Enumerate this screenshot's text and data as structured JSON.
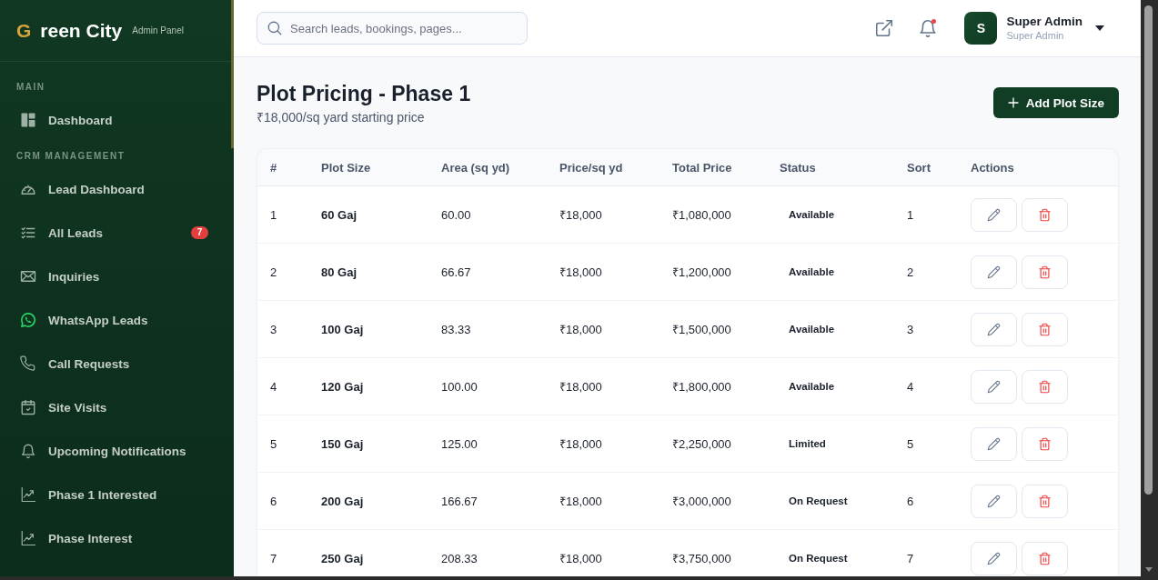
{
  "sidebar": {
    "logo": {
      "mark": "G",
      "name": "reen City",
      "subtitle": "Admin Panel"
    },
    "sections": [
      {
        "label": "MAIN",
        "items": [
          {
            "label": "Dashboard",
            "kind": "dashboard",
            "selected": false
          }
        ]
      },
      {
        "label": "CRM MANAGEMENT",
        "items": [
          {
            "label": "Lead Dashboard",
            "kind": "gauge",
            "selected": false
          },
          {
            "label": "All Leads",
            "kind": "list",
            "badge": "7",
            "selected": false
          },
          {
            "label": "Inquiries",
            "kind": "mail",
            "selected": false
          },
          {
            "label": "WhatsApp Leads",
            "kind": "whatsapp",
            "selected": false
          },
          {
            "label": "Call Requests",
            "kind": "phone",
            "selected": false
          },
          {
            "label": "Site Visits",
            "kind": "calendar",
            "selected": false
          },
          {
            "label": "Upcoming Notifications",
            "kind": "bell",
            "selected": false
          },
          {
            "label": "Phase 1 Interested",
            "kind": "chart",
            "selected": false
          },
          {
            "label": "Phase Interest",
            "kind": "chart",
            "selected": false
          }
        ]
      }
    ]
  },
  "topbar": {
    "search": {
      "placeholder": "Search leads, bookings, pages..."
    },
    "notifications": {
      "unread": true
    },
    "user": {
      "initial": "S",
      "name": "Super Admin",
      "role": "Super Admin"
    }
  },
  "page": {
    "title": "Plot Pricing - Phase 1",
    "subtitle": "₹18,000/sq yard starting price",
    "add_button": "Add Plot Size"
  },
  "table": {
    "columns": [
      "#",
      "Plot Size",
      "Area (sq yd)",
      "Price/sq yd",
      "Total Price",
      "Status",
      "Sort",
      "Actions"
    ],
    "rows": [
      {
        "index": "1",
        "plot_size": "60 Gaj",
        "area": "60.00",
        "price_per_sq_yd": "₹18,000",
        "total_price": "₹1,080,000",
        "status": "Available",
        "sort": "1"
      },
      {
        "index": "2",
        "plot_size": "80 Gaj",
        "area": "66.67",
        "price_per_sq_yd": "₹18,000",
        "total_price": "₹1,200,000",
        "status": "Available",
        "sort": "2"
      },
      {
        "index": "3",
        "plot_size": "100 Gaj",
        "area": "83.33",
        "price_per_sq_yd": "₹18,000",
        "total_price": "₹1,500,000",
        "status": "Available",
        "sort": "3"
      },
      {
        "index": "4",
        "plot_size": "120 Gaj",
        "area": "100.00",
        "price_per_sq_yd": "₹18,000",
        "total_price": "₹1,800,000",
        "status": "Available",
        "sort": "4"
      },
      {
        "index": "5",
        "plot_size": "150 Gaj",
        "area": "125.00",
        "price_per_sq_yd": "₹18,000",
        "total_price": "₹2,250,000",
        "status": "Limited",
        "sort": "5"
      },
      {
        "index": "6",
        "plot_size": "200 Gaj",
        "area": "166.67",
        "price_per_sq_yd": "₹18,000",
        "total_price": "₹3,000,000",
        "status": "On Request",
        "sort": "6"
      },
      {
        "index": "7",
        "plot_size": "250 Gaj",
        "area": "208.33",
        "price_per_sq_yd": "₹18,000",
        "total_price": "₹3,750,000",
        "status": "On Request",
        "sort": "7"
      }
    ]
  }
}
